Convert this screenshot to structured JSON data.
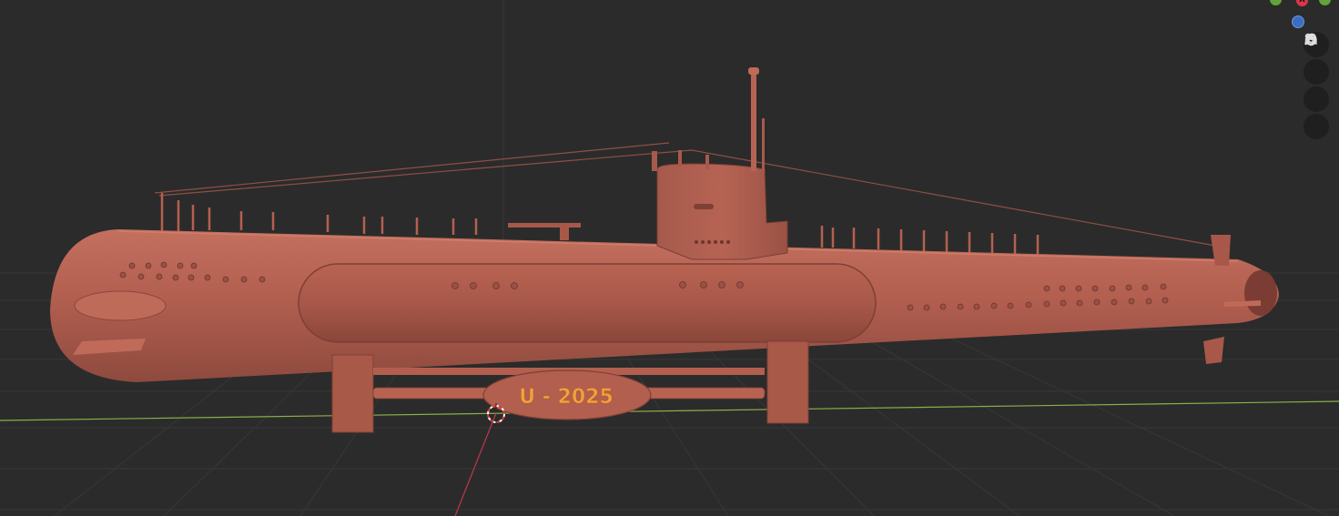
{
  "viewport": {
    "background": "#2b2b2b",
    "grid_color": "#3a3a3a",
    "x_axis_color": "#8ab04a",
    "y_axis_color": "#c0384a",
    "model_color": "#b76354"
  },
  "model": {
    "name_plate_text": "U - 2025",
    "name_plate_text_color": "#f0a040"
  },
  "gizmo": {
    "x_label": "X",
    "x_color": "#d9374a",
    "y_color": "#62a33a",
    "z_color": "#3b6ec2"
  },
  "tools": [
    {
      "icon": "zoom-icon"
    },
    {
      "icon": "hand-pan-icon"
    },
    {
      "icon": "camera-icon"
    },
    {
      "icon": "grid-perspective-icon"
    }
  ]
}
